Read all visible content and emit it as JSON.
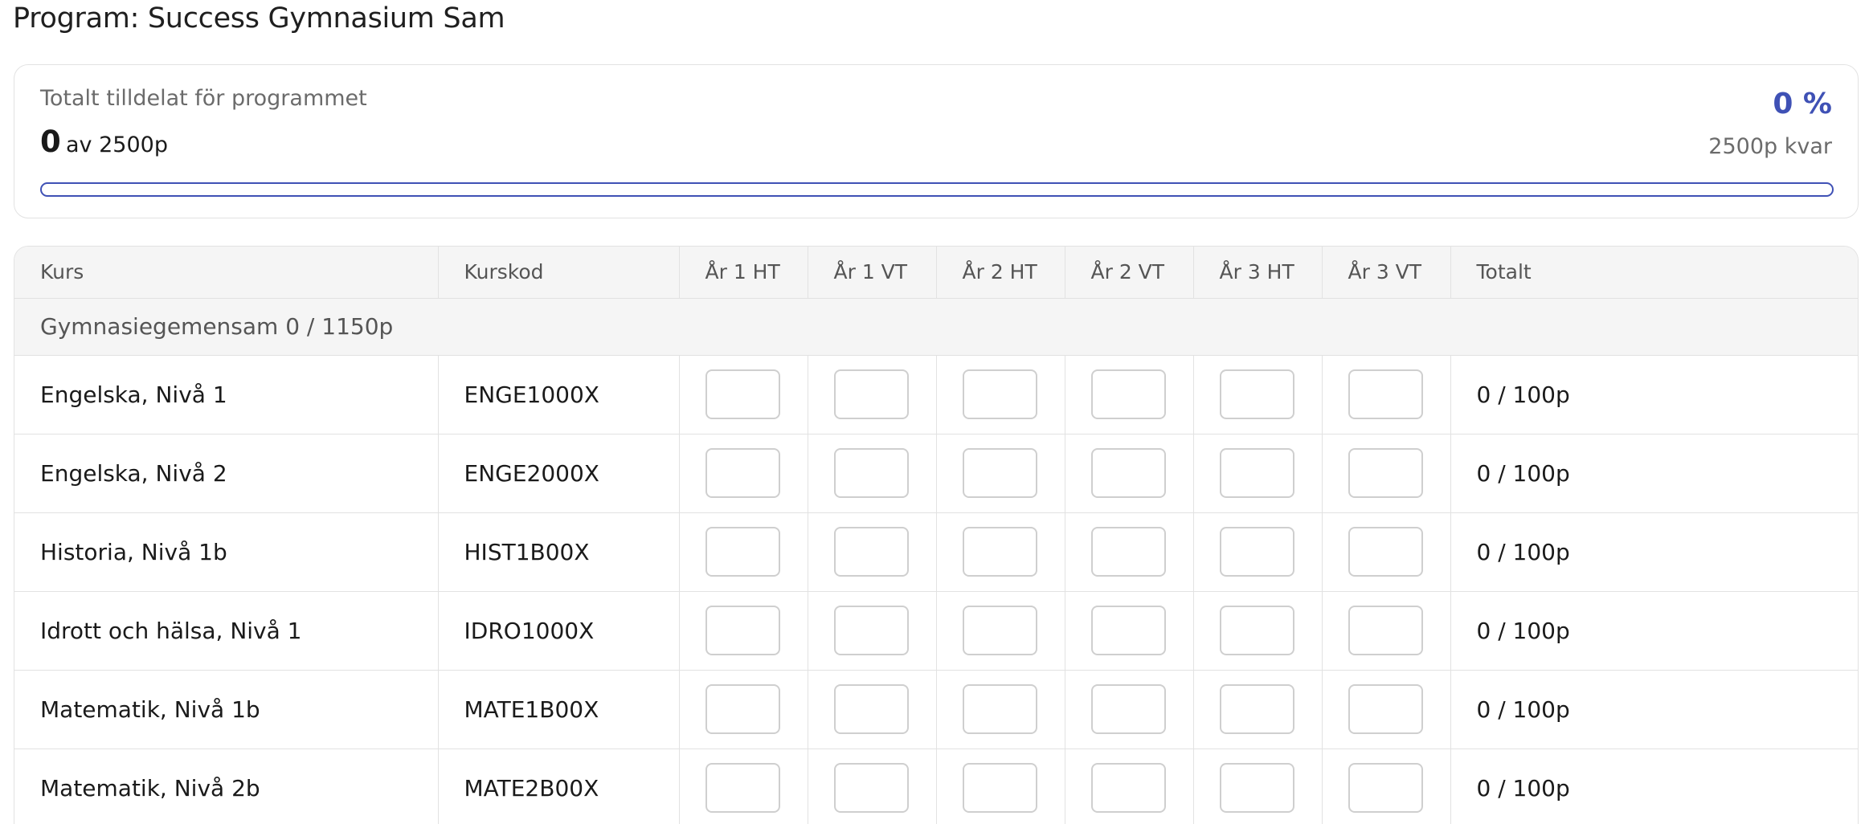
{
  "page": {
    "title": "Program: Success Gymnasium Sam"
  },
  "summary": {
    "label": "Totalt tilldelat för programmet",
    "used": "0",
    "of_total": "av 2500p",
    "percent_text": "0 %",
    "percent_value": 0,
    "remaining": "2500p kvar",
    "accent_color": "#3f51b5"
  },
  "table": {
    "headers": [
      "Kurs",
      "Kurskod",
      "År 1 HT",
      "År 1 VT",
      "År 2 HT",
      "År 2 VT",
      "År 3 HT",
      "År 3 VT",
      "Totalt"
    ],
    "group": {
      "label": "Gymnasiegemensam 0 / 1150p"
    },
    "rows": [
      {
        "course": "Engelska, Nivå 1",
        "code": "ENGE1000X",
        "total": "0 / 100p"
      },
      {
        "course": "Engelska, Nivå 2",
        "code": "ENGE2000X",
        "total": "0 / 100p"
      },
      {
        "course": "Historia, Nivå 1b",
        "code": "HIST1B00X",
        "total": "0 / 100p"
      },
      {
        "course": "Idrott och hälsa, Nivå 1",
        "code": "IDRO1000X",
        "total": "0 / 100p"
      },
      {
        "course": "Matematik, Nivå 1b",
        "code": "MATE1B00X",
        "total": "0 / 100p"
      },
      {
        "course": "Matematik, Nivå 2b",
        "code": "MATE2B00X",
        "total": "0 / 100p"
      }
    ]
  }
}
